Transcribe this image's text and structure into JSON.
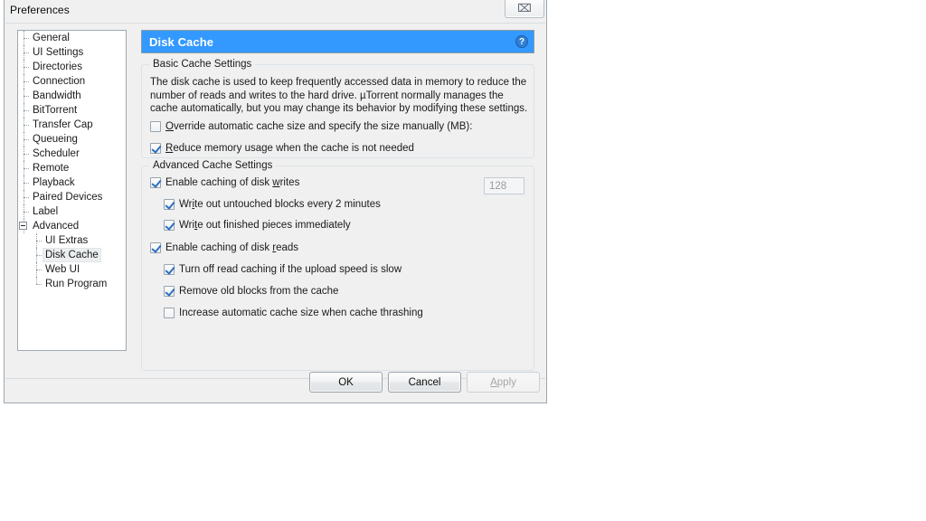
{
  "window": {
    "title": "Preferences",
    "close_button": "close-button",
    "close_glyph": "⌧"
  },
  "sidebar": {
    "items": [
      {
        "label": "General",
        "level": 1,
        "selected": false,
        "expander": false
      },
      {
        "label": "UI Settings",
        "level": 1,
        "selected": false,
        "expander": false
      },
      {
        "label": "Directories",
        "level": 1,
        "selected": false,
        "expander": false
      },
      {
        "label": "Connection",
        "level": 1,
        "selected": false,
        "expander": false
      },
      {
        "label": "Bandwidth",
        "level": 1,
        "selected": false,
        "expander": false
      },
      {
        "label": "BitTorrent",
        "level": 1,
        "selected": false,
        "expander": false
      },
      {
        "label": "Transfer Cap",
        "level": 1,
        "selected": false,
        "expander": false
      },
      {
        "label": "Queueing",
        "level": 1,
        "selected": false,
        "expander": false
      },
      {
        "label": "Scheduler",
        "level": 1,
        "selected": false,
        "expander": false
      },
      {
        "label": "Remote",
        "level": 1,
        "selected": false,
        "expander": false
      },
      {
        "label": "Playback",
        "level": 1,
        "selected": false,
        "expander": false
      },
      {
        "label": "Paired Devices",
        "level": 1,
        "selected": false,
        "expander": false
      },
      {
        "label": "Label",
        "level": 1,
        "selected": false,
        "expander": false
      },
      {
        "label": "Advanced",
        "level": 1,
        "selected": false,
        "expander": true
      },
      {
        "label": "UI Extras",
        "level": 2,
        "selected": false,
        "expander": false
      },
      {
        "label": "Disk Cache",
        "level": 2,
        "selected": true,
        "expander": false
      },
      {
        "label": "Web UI",
        "level": 2,
        "selected": false,
        "expander": false
      },
      {
        "label": "Run Program",
        "level": 2,
        "selected": false,
        "expander": false
      }
    ]
  },
  "page": {
    "header_title": "Disk Cache",
    "help_glyph": "?",
    "header_color": "#3399ff"
  },
  "basic_group": {
    "legend": "Basic Cache Settings",
    "description": "The disk cache is used to keep frequently accessed data in memory to reduce the number of reads and writes to the hard drive. µTorrent normally manages the cache automatically, but you may change its behavior by modifying these settings.",
    "override": {
      "label_before": "",
      "accel": "O",
      "label_after": "verride automatic cache size and specify the size manually (MB):",
      "checked": false
    },
    "cache_size_value": "128",
    "cache_size_enabled": false,
    "reduce_memory": {
      "accel": "R",
      "label_after": "educe memory usage when the cache is not needed",
      "checked": true
    }
  },
  "advanced_group": {
    "legend": "Advanced Cache Settings",
    "rows": [
      {
        "name": "enable-caching-writes",
        "before": "Enable caching of disk ",
        "accel": "w",
        "after": "rites",
        "checked": true,
        "indent": 0
      },
      {
        "name": "write-untouched-blocks",
        "before": "Wr",
        "accel": "i",
        "after": "te out untouched blocks every 2 minutes",
        "checked": true,
        "indent": 1
      },
      {
        "name": "write-finished-pieces",
        "before": "Wri",
        "accel": "t",
        "after": "e out finished pieces immediately",
        "checked": true,
        "indent": 1
      },
      {
        "name": "enable-caching-reads",
        "before": "Enable caching of disk ",
        "accel": "r",
        "after": "eads",
        "checked": true,
        "indent": 0
      },
      {
        "name": "turn-off-read-caching",
        "before": "Turn off read caching if the upload speed is slow",
        "accel": "",
        "after": "",
        "checked": true,
        "indent": 1
      },
      {
        "name": "remove-old-blocks",
        "before": "Remove old blocks from the cache",
        "accel": "",
        "after": "",
        "checked": true,
        "indent": 1
      },
      {
        "name": "increase-cache-size",
        "before": "Increase automatic cache size when cache thrashing",
        "accel": "",
        "after": "",
        "checked": false,
        "indent": 1
      }
    ]
  },
  "footer": {
    "ok_label": "OK",
    "cancel_label": "Cancel",
    "apply_accel": "A",
    "apply_rest": "pply",
    "apply_enabled": false
  }
}
